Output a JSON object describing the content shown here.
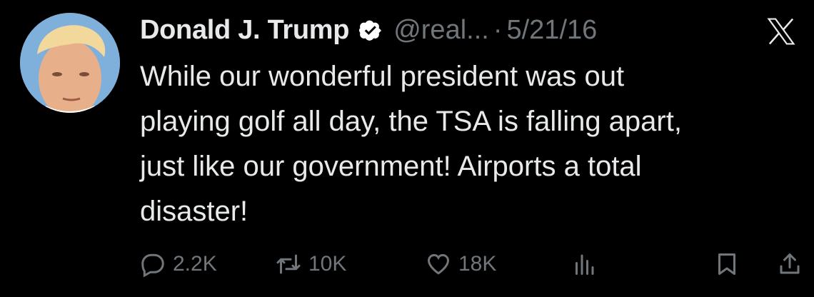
{
  "author": {
    "name": "Donald J. Trump",
    "handle": "@real...",
    "separator": "·",
    "date": "5/21/16",
    "verified": true
  },
  "tweet": {
    "text": "While our wonderful president was out\nplaying golf all day, the TSA is falling apart,\njust like our government! Airports a total\ndisaster!"
  },
  "metrics": {
    "replies": "2.2K",
    "retweets": "10K",
    "likes": "18K"
  },
  "icons": {
    "reply": "speech-bubble-icon",
    "retweet": "retweet-arrows-icon",
    "like": "heart-icon",
    "views": "bar-chart-icon",
    "bookmark": "bookmark-icon",
    "share": "share-upload-icon",
    "brand": "x-logo-icon"
  },
  "colors": {
    "background": "#000000",
    "text": "#e7e9ea",
    "muted": "#71767b",
    "verified_badge": "#ffffff"
  }
}
